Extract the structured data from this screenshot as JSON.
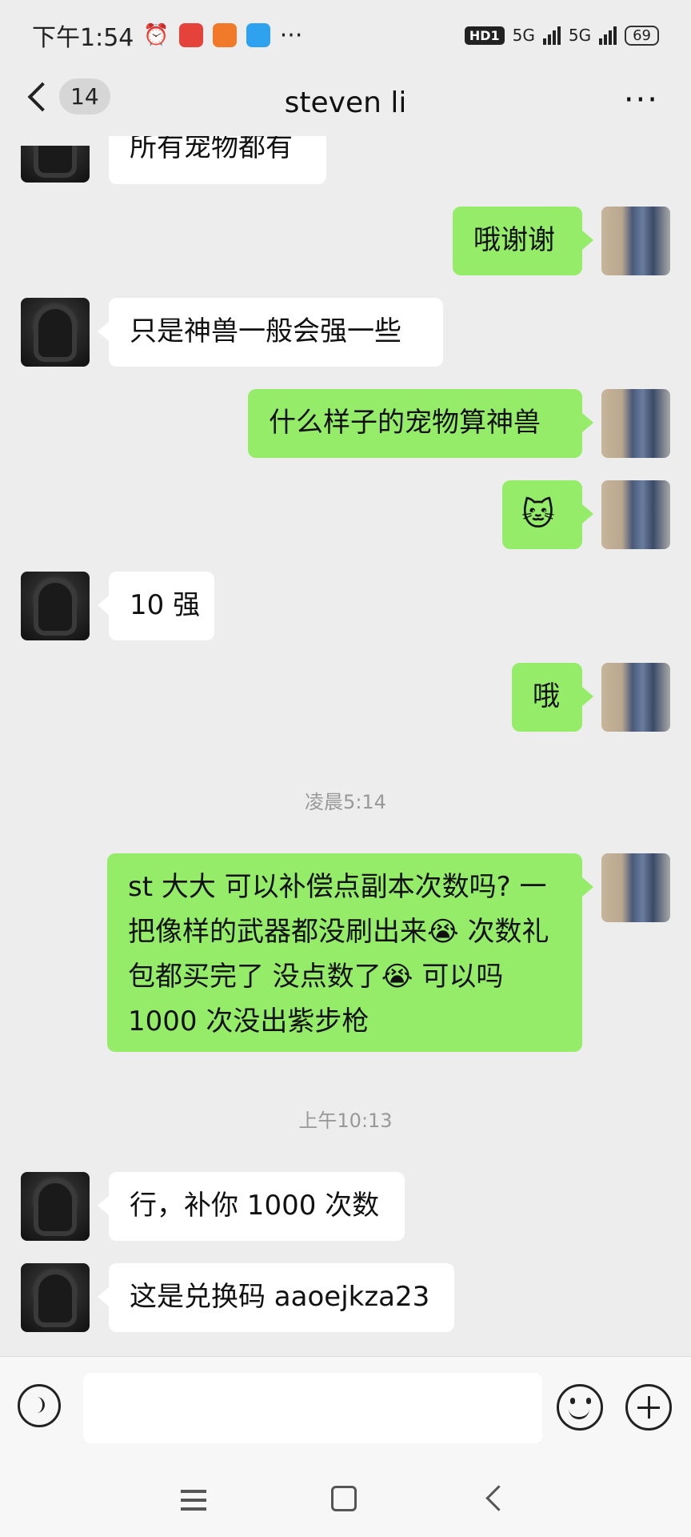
{
  "status": {
    "time": "下午1:54",
    "app_icons": [
      "alarm-icon",
      "taobao-icon",
      "app-icon-orange",
      "app-icon-blue"
    ],
    "more": "···",
    "network": "HD1",
    "signal1": "5G",
    "signal2": "5G",
    "battery": "69"
  },
  "header": {
    "back_count": "14",
    "title": "steven li",
    "more": "···"
  },
  "messages": [
    {
      "side": "in",
      "text": "所有宠物都有"
    },
    {
      "side": "out",
      "text": "哦谢谢"
    },
    {
      "side": "in",
      "text": "只是神兽一般会强一些"
    },
    {
      "side": "out",
      "text": "什么样子的宠物算神兽"
    },
    {
      "side": "out",
      "text": "🐱",
      "type": "sticker"
    },
    {
      "side": "in",
      "text": "10 强"
    },
    {
      "side": "out",
      "text": "哦"
    },
    {
      "side": "out",
      "text": "st 大大 可以补偿点副本次数吗? 一把像样的武器都没刷出来😭 次数礼包都买完了 没点数了😭 可以吗 1000 次没出紫步枪"
    },
    {
      "side": "in",
      "text": "行，补你 1000 次数"
    },
    {
      "side": "in",
      "text": "这是兑换码 aaoejkza23"
    }
  ],
  "timestamps": [
    "凌晨5:14",
    "上午10:13"
  ],
  "input": {
    "value": "",
    "placeholder": ""
  },
  "colors": {
    "outgoing": "#95ec69",
    "incoming": "#ffffff",
    "background": "#ededed"
  }
}
